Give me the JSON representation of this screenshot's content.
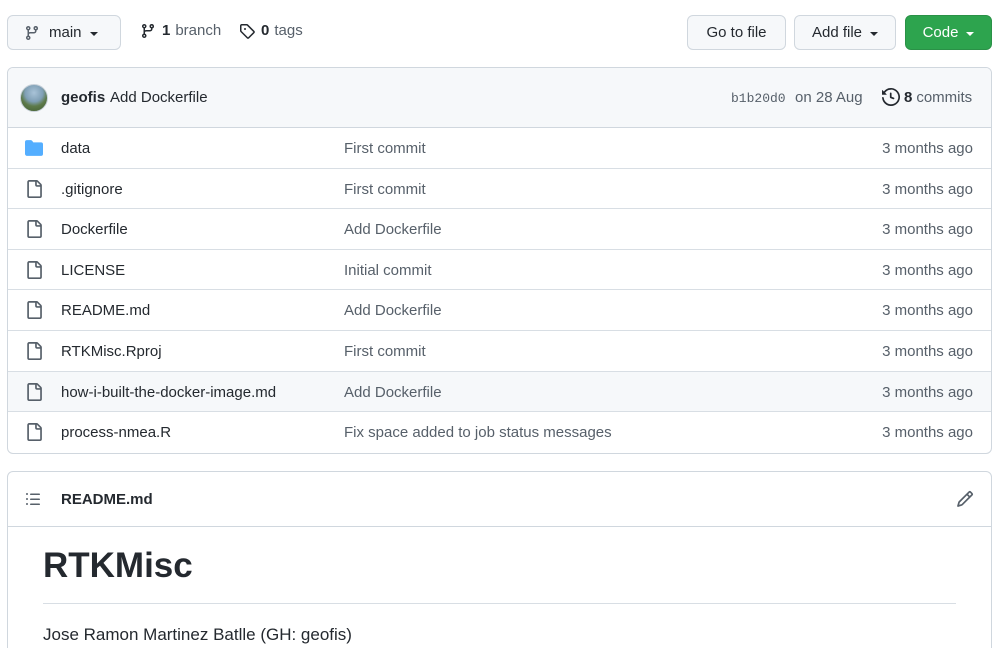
{
  "toolbar": {
    "branch_label": "main",
    "branch_count": "1",
    "branch_word": "branch",
    "tag_count": "0",
    "tag_word": "tags",
    "goto_label": "Go to file",
    "add_label": "Add file",
    "code_label": "Code"
  },
  "latest_commit": {
    "author": "geofis",
    "message": "Add Dockerfile",
    "sha": "b1b20d0",
    "date": "on 28 Aug",
    "commit_count": "8",
    "commit_word": "commits"
  },
  "files": [
    {
      "name": "data",
      "message": "First commit",
      "age": "3 months ago",
      "type": "folder"
    },
    {
      "name": ".gitignore",
      "message": "First commit",
      "age": "3 months ago",
      "type": "file"
    },
    {
      "name": "Dockerfile",
      "message": "Add Dockerfile",
      "age": "3 months ago",
      "type": "file"
    },
    {
      "name": "LICENSE",
      "message": "Initial commit",
      "age": "3 months ago",
      "type": "file"
    },
    {
      "name": "README.md",
      "message": "Add Dockerfile",
      "age": "3 months ago",
      "type": "file"
    },
    {
      "name": "RTKMisc.Rproj",
      "message": "First commit",
      "age": "3 months ago",
      "type": "file"
    },
    {
      "name": "how-i-built-the-docker-image.md",
      "message": "Add Dockerfile",
      "age": "3 months ago",
      "type": "file"
    },
    {
      "name": "process-nmea.R",
      "message": "Fix space added to job status messages",
      "age": "3 months ago",
      "type": "file"
    }
  ],
  "readme": {
    "filename": "README.md",
    "heading": "RTKMisc",
    "paragraph": "Jose Ramon Martinez Batlle (GH: geofis)"
  },
  "colors": {
    "code_button": "#2da44e",
    "folder_icon": "#54aeff",
    "muted_text": "#57606a"
  },
  "icons": [
    "git-branch-icon",
    "tag-icon",
    "history-icon",
    "folder-icon",
    "file-icon",
    "list-icon",
    "pencil-icon"
  ]
}
